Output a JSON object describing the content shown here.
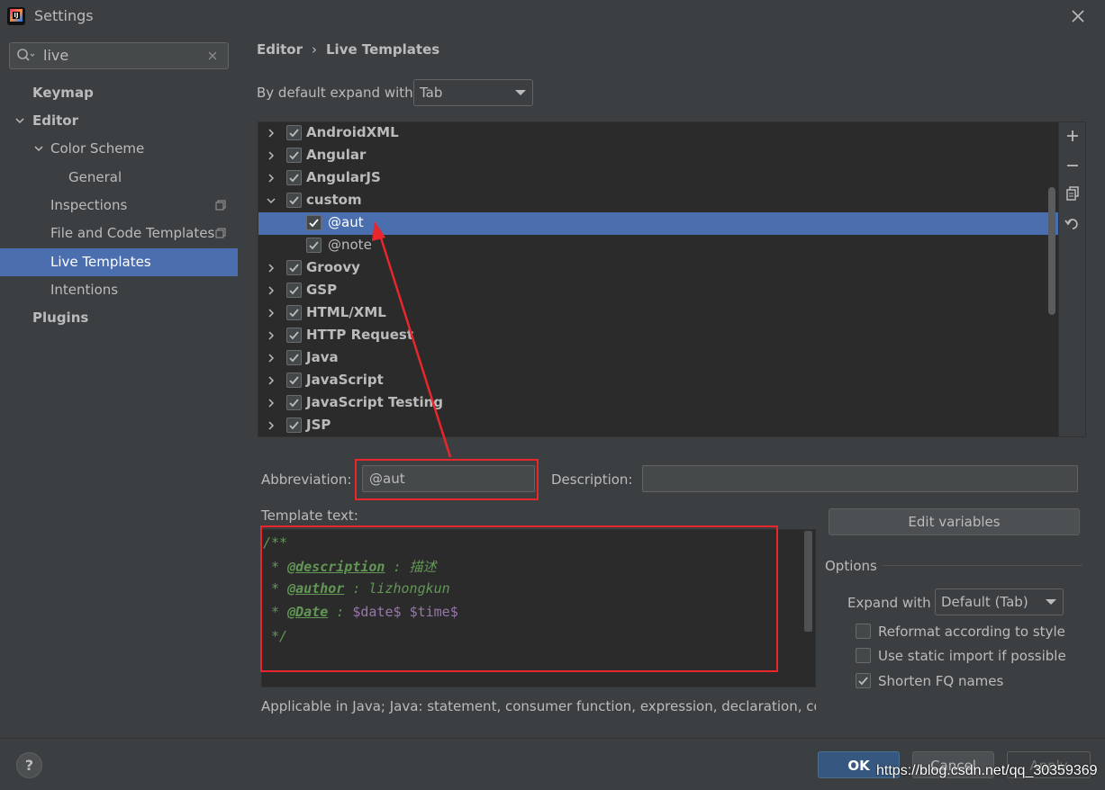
{
  "window": {
    "title": "Settings"
  },
  "search": {
    "value": "live"
  },
  "sidebar": {
    "items": [
      {
        "label": "Keymap"
      },
      {
        "label": "Editor"
      },
      {
        "label": "Color Scheme"
      },
      {
        "label": "General"
      },
      {
        "label": "Inspections"
      },
      {
        "label": "File and Code Templates"
      },
      {
        "label": "Live Templates"
      },
      {
        "label": "Intentions"
      },
      {
        "label": "Plugins"
      }
    ]
  },
  "breadcrumb": {
    "parent": "Editor",
    "separator": "›",
    "current": "Live Templates"
  },
  "expand_default": {
    "label": "By default expand with",
    "value": "Tab"
  },
  "tree": {
    "rows": [
      {
        "label": "AndroidXML",
        "checked": true
      },
      {
        "label": "Angular",
        "checked": true
      },
      {
        "label": "AngularJS",
        "checked": true
      },
      {
        "label": "custom",
        "checked": true
      },
      {
        "label": "@aut",
        "checked": true
      },
      {
        "label": "@note",
        "checked": true
      },
      {
        "label": "Groovy",
        "checked": true
      },
      {
        "label": "GSP",
        "checked": true
      },
      {
        "label": "HTML/XML",
        "checked": true
      },
      {
        "label": "HTTP Request",
        "checked": true
      },
      {
        "label": "Java",
        "checked": true
      },
      {
        "label": "JavaScript",
        "checked": true
      },
      {
        "label": "JavaScript Testing",
        "checked": true
      },
      {
        "label": "JSP",
        "checked": true
      }
    ],
    "toolbar_icons": [
      "add-icon",
      "remove-icon",
      "copy-icon",
      "restore-icon"
    ]
  },
  "detail": {
    "abbreviation_label": "Abbreviation:",
    "abbreviation_value": "@aut",
    "description_label": "Description:",
    "description_value": "",
    "template_text_label": "Template text:",
    "code": {
      "line1": "/**",
      "line2_prefix": " * ",
      "line2_tag": "@description",
      "line2_rest": " : 描述",
      "line3_prefix": " * ",
      "line3_tag": "@author",
      "line3_rest": " : lizhongkun",
      "line4_prefix": " * ",
      "line4_tag": "@Date",
      "line4_mid": " : ",
      "line4_var1": "$date$",
      "line4_sp": " ",
      "line4_var2": "$time$",
      "line5": " */"
    },
    "applicable": "Applicable in Java; Java: statement, consumer function, expression, declaration, comr",
    "edit_variables": "Edit variables"
  },
  "options": {
    "title": "Options",
    "expand_with_label": "Expand with",
    "expand_with_value": "Default (Tab)",
    "checkboxes": [
      {
        "label": "Reformat according to style",
        "checked": false
      },
      {
        "label": "Use static import if possible",
        "checked": false
      },
      {
        "label": "Shorten FQ names",
        "checked": true
      }
    ]
  },
  "buttons": {
    "help": "?",
    "ok": "OK",
    "cancel": "Cancel",
    "apply": "Apply"
  },
  "watermark": "https://blog.csdn.net/qq_30359369",
  "colors": {
    "selection": "#4b6eaf",
    "annotation_red": "#e8262c",
    "background": "#3c3f41",
    "tree_background": "#2b2b2b"
  }
}
